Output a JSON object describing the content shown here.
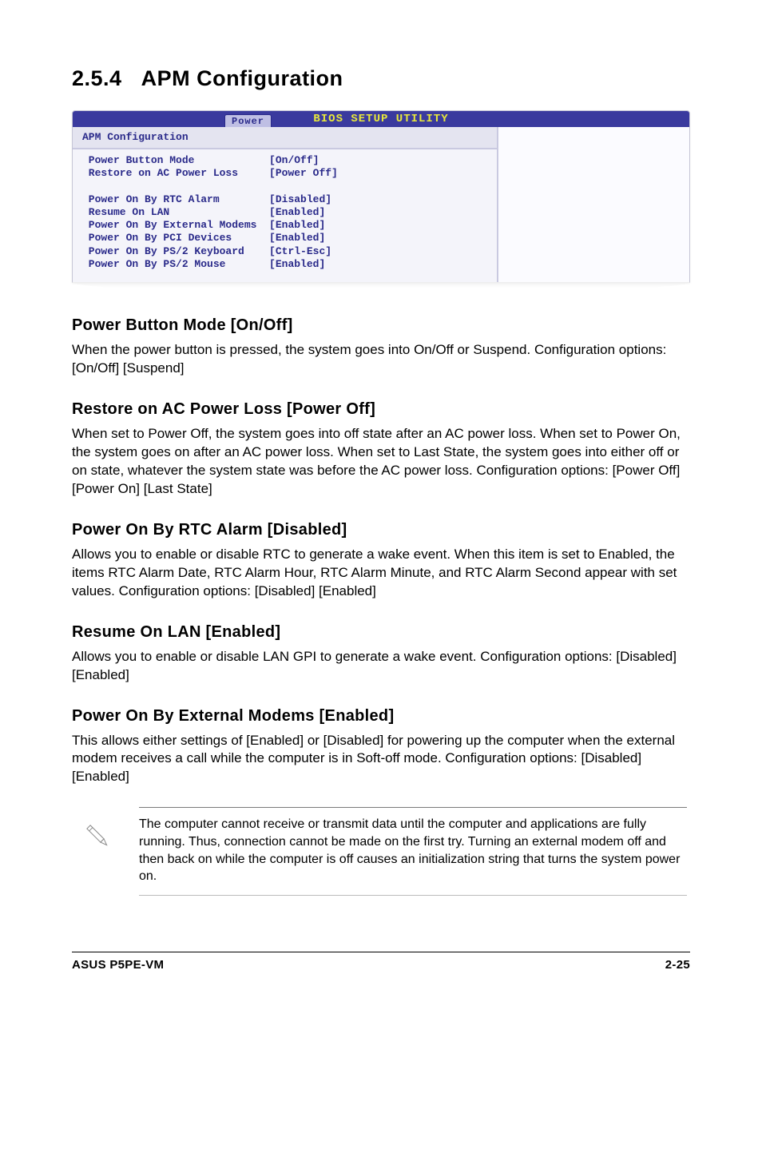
{
  "section": {
    "number": "2.5.4",
    "title": "APM Configuration"
  },
  "bios": {
    "top_title": "BIOS SETUP UTILITY",
    "tab": "Power",
    "panel_title": "APM Configuration",
    "rows": [
      {
        "label": "Power Button Mode",
        "value": "[On/Off]"
      },
      {
        "label": "Restore on AC Power Loss",
        "value": "[Power Off]"
      },
      {
        "label": "",
        "value": ""
      },
      {
        "label": "Power On By RTC Alarm",
        "value": "[Disabled]"
      },
      {
        "label": "Resume On LAN",
        "value": "[Enabled]"
      },
      {
        "label": "Power On By External Modems",
        "value": "[Enabled]"
      },
      {
        "label": "Power On By PCI Devices",
        "value": "[Enabled]"
      },
      {
        "label": "Power On By PS/2 Keyboard",
        "value": "[Ctrl-Esc]"
      },
      {
        "label": "Power On By PS/2 Mouse",
        "value": "[Enabled]"
      }
    ]
  },
  "items": {
    "pbm": {
      "head": "Power Button Mode [On/Off]",
      "body": "When the power button is pressed, the system goes into On/Off or Suspend. Configuration options: [On/Off] [Suspend]"
    },
    "racpl": {
      "head": "Restore on AC Power Loss [Power Off]",
      "body": "When set to Power Off, the system goes into off state after an AC power loss. When set to Power On, the system goes on after an AC power loss. When set to Last State, the system goes into either off or on state, whatever the system state was before the AC power loss. Configuration options: [Power Off] [Power On] [Last State]"
    },
    "rtc": {
      "head": "Power On By RTC Alarm [Disabled]",
      "body": "Allows you to enable or disable RTC to generate a wake event. When this item is set to Enabled, the items RTC Alarm Date, RTC Alarm Hour, RTC Alarm Minute, and RTC Alarm Second appear with set values. Configuration options: [Disabled] [Enabled]"
    },
    "lan": {
      "head": "Resume On LAN [Enabled]",
      "body": "Allows you to enable or disable LAN GPI to generate a wake event. Configuration options: [Disabled] [Enabled]"
    },
    "modem": {
      "head": "Power On By External Modems [Enabled]",
      "body": "This allows either settings of [Enabled] or [Disabled] for powering up the computer when the external modem receives a call while the computer is in Soft-off mode. Configuration options: [Disabled] [Enabled]"
    }
  },
  "note": "The computer cannot receive or transmit data until the computer and applications are fully running. Thus, connection cannot be made on the first try. Turning an external modem off and then back on while the computer is off causes an initialization string that turns the system power on.",
  "footer": {
    "left": "ASUS P5PE-VM",
    "right": "2-25"
  }
}
